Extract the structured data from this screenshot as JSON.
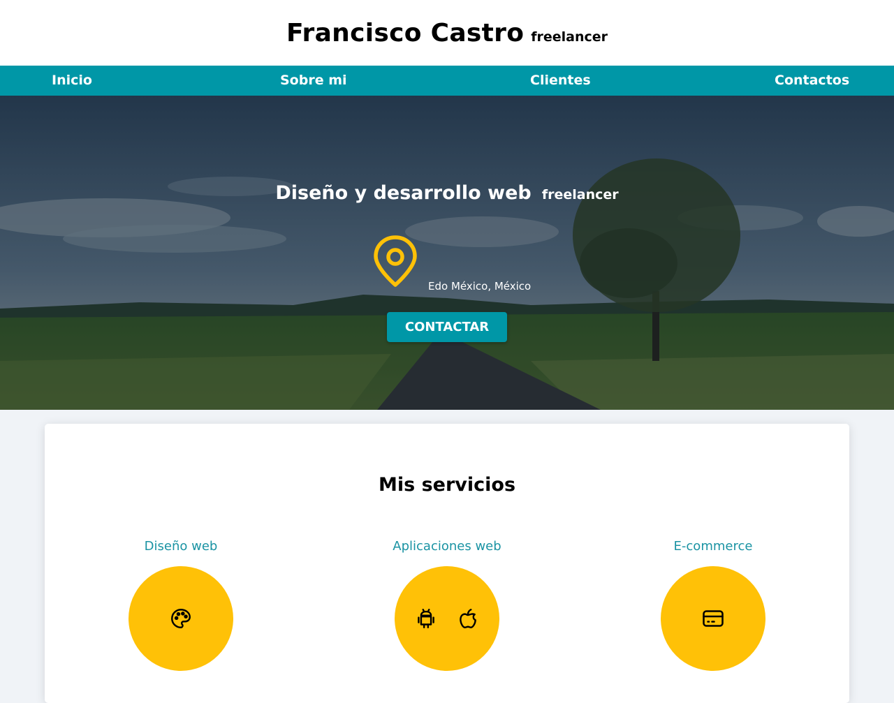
{
  "header": {
    "name": "Francisco Castro",
    "tag": "freelancer"
  },
  "nav": {
    "items": [
      {
        "label": "Inicio"
      },
      {
        "label": "Sobre mi"
      },
      {
        "label": "Clientes"
      },
      {
        "label": "Contactos"
      }
    ]
  },
  "hero": {
    "title": "Diseño y desarrollo web",
    "title_tag": "freelancer",
    "location": "Edo México, México",
    "cta_label": "CONTACTAR"
  },
  "services": {
    "title": "Mis servicios",
    "items": [
      {
        "name": "Diseño web",
        "icons": [
          "palette-icon"
        ]
      },
      {
        "name": "Aplicaciones web",
        "icons": [
          "android-icon",
          "apple-icon"
        ]
      },
      {
        "name": "E-commerce",
        "icons": [
          "credit-card-icon"
        ]
      }
    ]
  },
  "colors": {
    "primary": "#0097a7",
    "accent": "#ffc107",
    "background": "#f0f3f7"
  }
}
